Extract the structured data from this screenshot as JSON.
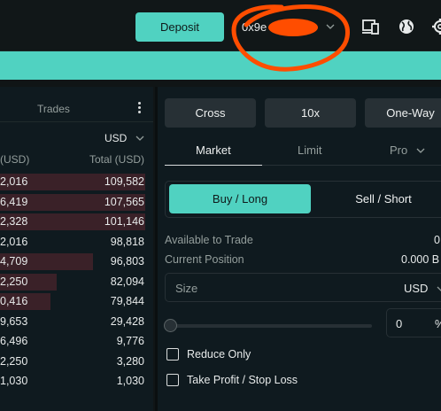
{
  "header": {
    "deposit_label": "Deposit",
    "wallet_label": "0x9e",
    "icons": [
      "devices-icon",
      "globe-icon",
      "gear-icon"
    ]
  },
  "colors": {
    "accent": "#50d2c1",
    "background": "#0f1a1f",
    "sell_depth": "#3a2128",
    "annotation": "#ff4d00"
  },
  "trades": {
    "title": "Trades",
    "unit": "USD",
    "col_price": "(USD)",
    "col_total": "Total (USD)",
    "rows": [
      {
        "price": "2,016",
        "total": "109,582",
        "depth": 1.0
      },
      {
        "price": "6,419",
        "total": "107,565",
        "depth": 1.0
      },
      {
        "price": "2,328",
        "total": "101,146",
        "depth": 1.0
      },
      {
        "price": "2,016",
        "total": "98,818",
        "depth": 0.0
      },
      {
        "price": "4,709",
        "total": "96,803",
        "depth": 0.64
      },
      {
        "price": "2,250",
        "total": "82,094",
        "depth": 0.39
      },
      {
        "price": "0,416",
        "total": "79,844",
        "depth": 0.35
      },
      {
        "price": "9,653",
        "total": "29,428",
        "depth": 0.0
      },
      {
        "price": "6,496",
        "total": "9,776",
        "depth": 0.0
      },
      {
        "price": "2,250",
        "total": "3,280",
        "depth": 0.0
      },
      {
        "price": "1,030",
        "total": "1,030",
        "depth": 0.0
      }
    ]
  },
  "order": {
    "margin_mode": "Cross",
    "leverage": "10x",
    "position_mode": "One-Way",
    "tabs": {
      "market": "Market",
      "limit": "Limit",
      "pro": "Pro"
    },
    "buy_label": "Buy / Long",
    "sell_label": "Sell / Short",
    "available_label": "Available to Trade",
    "available_value": "0",
    "position_label": "Current Position",
    "position_value": "0.000 B",
    "size_placeholder": "Size",
    "size_unit": "USD",
    "percent_value": "0",
    "percent_sign": "%",
    "reduce_only": "Reduce Only",
    "tp_sl": "Take Profit / Stop Loss"
  }
}
